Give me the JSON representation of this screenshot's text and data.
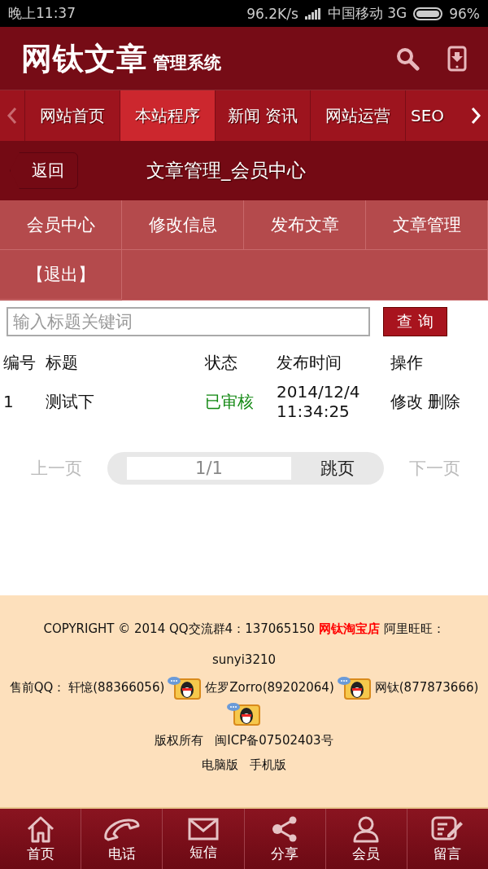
{
  "status_bar": {
    "time": "晚上11:37",
    "speed": "96.2K/s",
    "carrier": "中国移动 3G",
    "battery": "96%"
  },
  "header": {
    "logo_main": "网钛文章",
    "logo_sub": "管理系统"
  },
  "nav_tabs": [
    {
      "label": "网站首页",
      "selected": false
    },
    {
      "label": "本站程序",
      "selected": true
    },
    {
      "label": "新闻 资讯",
      "selected": false
    },
    {
      "label": "网站运营",
      "selected": false
    },
    {
      "label": "SEO",
      "selected": false
    }
  ],
  "page_header": {
    "back": "返回",
    "title": "文章管理_会员中心"
  },
  "member_menu": [
    "会员中心",
    "修改信息",
    "发布文章",
    "文章管理",
    "【退出】"
  ],
  "search": {
    "placeholder": "输入标题关键词",
    "button": "查 询"
  },
  "table": {
    "columns": [
      "编号",
      "标题",
      "状态",
      "发布时间",
      "操作"
    ],
    "rows": [
      {
        "id": "1",
        "title": "测试下",
        "status": "已审核",
        "time": "2014/12/4 11:34:25",
        "actions": [
          "修改",
          "删除"
        ]
      }
    ]
  },
  "pagination": {
    "prev": {
      "label": "上一页",
      "disabled": true
    },
    "page": "1/1",
    "jump": "跳页",
    "next": {
      "label": "下一页",
      "disabled": true
    }
  },
  "footer": {
    "copyright": "COPYRIGHT © 2014 QQ交流群4：137065150",
    "shop_link": "网钛淘宝店",
    "wangwang": "阿里旺旺：sunyi3210",
    "presales_label": "售前QQ：",
    "contacts": [
      "轩憶(88366056)",
      "佐罗Zorro(89202064)",
      "网钛(877873666)"
    ],
    "rights": "版权所有",
    "icp": "闽ICP备07502403号",
    "versions": [
      "电脑版",
      "手机版"
    ]
  },
  "bottom_nav": [
    {
      "label": "首页",
      "kind": "home"
    },
    {
      "label": "电话",
      "kind": "phone"
    },
    {
      "label": "短信",
      "kind": "mail"
    },
    {
      "label": "分享",
      "kind": "share"
    },
    {
      "label": "会员",
      "kind": "user"
    },
    {
      "label": "留言",
      "kind": "note"
    }
  ]
}
